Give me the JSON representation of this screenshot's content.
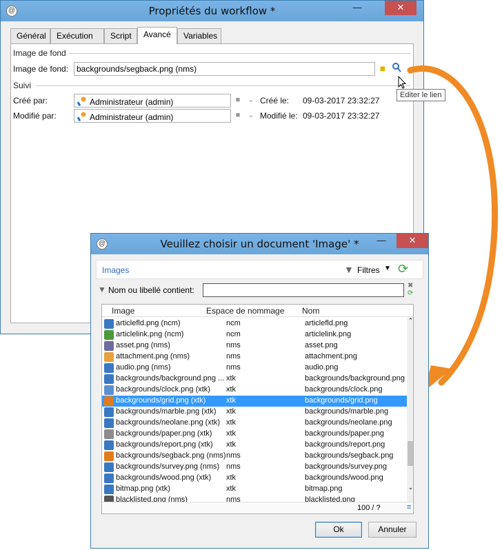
{
  "main_window": {
    "title": "Propriétés du workflow *",
    "tabs": [
      "Général",
      "Exécution",
      "Script",
      "Avancé",
      "Variables"
    ],
    "active_tab": "Avancé",
    "background_section": "Image de fond",
    "background_label": "Image de fond:",
    "background_value": "backgrounds/segback.png (nms)",
    "suivi_section": "Suivi",
    "created_by_label": "Créé par:",
    "created_by_value": "Administrateur (admin)",
    "created_on_label": "Créé le:",
    "created_on_value": "09-03-2017 23:32:27",
    "modified_by_label": "Modifié par:",
    "modified_by_value": "Administrateur (admin)",
    "modified_on_label": "Modifié le:",
    "modified_on_value": "09-03-2017 23:32:27",
    "tooltip": "Editer le lien"
  },
  "chooser": {
    "title": "Veuillez choisir un document 'Image' *",
    "folder_label": "Images",
    "filters_label": "Filtres",
    "search_label": "Nom ou libellé contient:",
    "search_value": "",
    "columns": [
      "Image",
      "Espace de nommage",
      "Nom"
    ],
    "rows": [
      {
        "image": "articlefld.png (ncm)",
        "ns": "ncm",
        "name": "articlefld.png",
        "icon": "#3a78c2"
      },
      {
        "image": "articlelink.png (ncm)",
        "ns": "ncm",
        "name": "articlelink.png",
        "icon": "#4a9a3c"
      },
      {
        "image": "asset.png (nms)",
        "ns": "nms",
        "name": "asset.png",
        "icon": "#6c6c9c"
      },
      {
        "image": "attachment.png (nms)",
        "ns": "nms",
        "name": "attachment.png",
        "icon": "#e6a23c"
      },
      {
        "image": "audio.png (nms)",
        "ns": "nms",
        "name": "audio.png",
        "icon": "#3a78c2"
      },
      {
        "image": "backgrounds/background.png ...",
        "ns": "xtk",
        "name": "backgrounds/background.png",
        "icon": "#3a78c2"
      },
      {
        "image": "backgrounds/clock.png (xtk)",
        "ns": "xtk",
        "name": "backgrounds/clock.png",
        "icon": "#5a8fd0"
      },
      {
        "image": "backgrounds/grid.png (xtk)",
        "ns": "xtk",
        "name": "backgrounds/grid.png",
        "icon": "#e07b1c"
      },
      {
        "image": "backgrounds/marble.png (xtk)",
        "ns": "xtk",
        "name": "backgrounds/marble.png",
        "icon": "#3a78c2"
      },
      {
        "image": "backgrounds/neolane.png (xtk)",
        "ns": "xtk",
        "name": "backgrounds/neolane.png",
        "icon": "#3a78c2"
      },
      {
        "image": "backgrounds/paper.png (xtk)",
        "ns": "xtk",
        "name": "backgrounds/paper.png",
        "icon": "#8c8c8c"
      },
      {
        "image": "backgrounds/report.png (xtk)",
        "ns": "xtk",
        "name": "backgrounds/report.png",
        "icon": "#3a78c2"
      },
      {
        "image": "backgrounds/segback.png (nms)",
        "ns": "nms",
        "name": "backgrounds/segback.png",
        "icon": "#e07b1c"
      },
      {
        "image": "backgrounds/survey.png (nms)",
        "ns": "nms",
        "name": "backgrounds/survey.png",
        "icon": "#3a78c2"
      },
      {
        "image": "backgrounds/wood.png (xtk)",
        "ns": "xtk",
        "name": "backgrounds/wood.png",
        "icon": "#3a78c2"
      },
      {
        "image": "bitmap.png (xtk)",
        "ns": "xtk",
        "name": "bitmap.png",
        "icon": "#3a78c2"
      },
      {
        "image": "blacklisted.png (nms)",
        "ns": "nms",
        "name": "blacklisted.png",
        "icon": "#555555"
      }
    ],
    "selected_index": 7,
    "count_label": "100 / ?",
    "ok_label": "Ok",
    "cancel_label": "Annuler"
  },
  "colors": {
    "titlebar": "#6aa5d9",
    "close": "#c75050",
    "selection": "#3399ff",
    "arrow": "#f08a24"
  }
}
